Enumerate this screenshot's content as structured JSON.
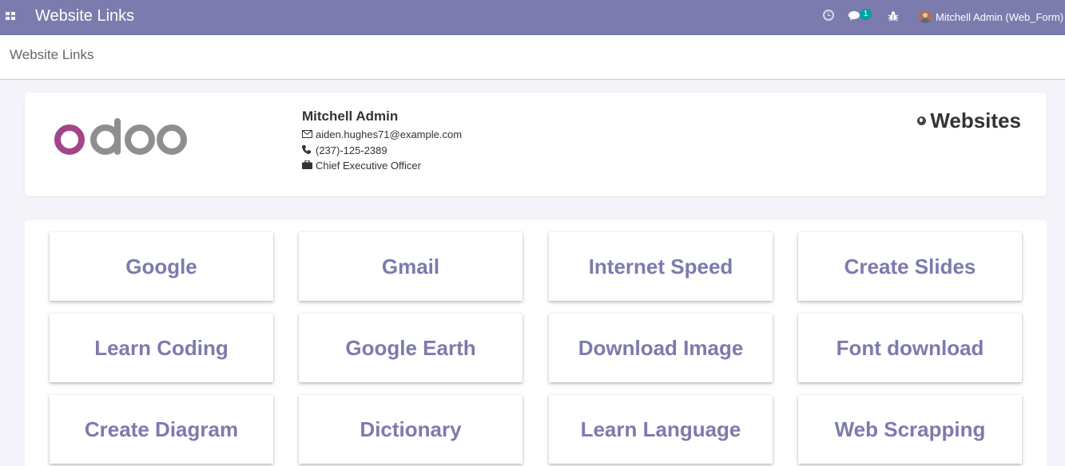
{
  "app": {
    "title": "Website Links"
  },
  "navbar": {
    "chat_count": "1",
    "user_name": "Mitchell Admin (Web_Form)"
  },
  "breadcrumb": "Website Links",
  "profile": {
    "name": "Mitchell Admin",
    "email": "aiden.hughes71@example.com",
    "phone": "(237)-125-2389",
    "job_title": "Chief Executive Officer"
  },
  "websites_heading": "Websites",
  "links": [
    "Google",
    "Gmail",
    "Internet Speed",
    "Create Slides",
    "Learn Coding",
    "Google Earth",
    "Download Image",
    "Font download",
    "Create Diagram",
    "Dictionary",
    "Learn Language",
    "Web Scrapping"
  ],
  "colors": {
    "navbar": "#7c7bad",
    "accent": "#7c7bad",
    "badge": "#00a09d",
    "logo_purple": "#a24689",
    "logo_gray": "#8f8f8f"
  },
  "icons": {
    "apps": "apps-grid-icon",
    "activity": "clock-icon",
    "messages": "chat-icon",
    "debug": "bug-icon",
    "email": "envelope-icon",
    "phone": "phone-icon",
    "job": "briefcase-icon",
    "websites": "globe-icon"
  }
}
